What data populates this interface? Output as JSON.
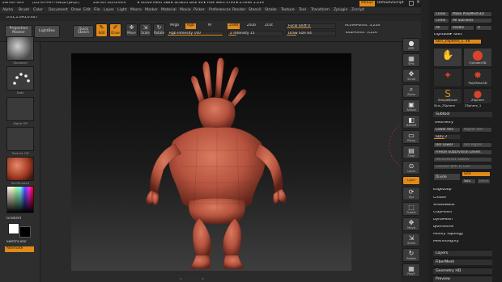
{
  "title_bar": {
    "app": "ZBrush 4R4",
    "build": "[ZDTK-PMFF-HNQDTJBQZ]",
    "document": "ZBrush Document",
    "stats": "▸ Active Mem 588 ▸ Scratch Disk 93 ▸ Free Mem 3793 ▸ ZTimer 2.219",
    "menus_button": "Menus",
    "script_button": "DefaultZScript"
  },
  "menu_bar": [
    "Alpha",
    "Brush",
    "Color",
    "Document",
    "Draw",
    "Edit",
    "File",
    "Layer",
    "Light",
    "Macro",
    "Marker",
    "Material",
    "Movie",
    "Picker",
    "Preferences",
    "Render",
    "Stencil",
    "Stroke",
    "Texture",
    "Tool",
    "Transform",
    "Zplugin",
    "Zscript"
  ],
  "coords": "0.01,1.095,0.447",
  "shelf": {
    "projection_master": "Projection Master",
    "lightbox": "LightBox",
    "quick_sketch": "Quick Sketch",
    "tools": [
      {
        "label": "Edit",
        "glyph": "✎",
        "active": true
      },
      {
        "label": "Draw",
        "glyph": "✐",
        "active": true
      },
      {
        "label": "Move",
        "glyph": "✥",
        "active": false
      },
      {
        "label": "Scale",
        "glyph": "⇲",
        "active": false
      },
      {
        "label": "Rotate",
        "glyph": "↻",
        "active": false
      }
    ],
    "mrgb": "Mrgb",
    "rgb": "Rgb",
    "m": "M",
    "rgb_intensity": "Rgb Intensity 100",
    "zadd": "Zadd",
    "zsub": "Zsub",
    "zcut": "Zcut",
    "z_intensity": "Z Intensity 15",
    "focal_shift": "Focal Shift 0",
    "draw_size": "Draw Size 64",
    "active_points": "ActivePoints: 3,226",
    "total_points": "TotalPoints: 3,226"
  },
  "left_tray": {
    "brush_caption": "Standard",
    "stroke_caption": "Dots",
    "alpha_caption": "Alpha Off",
    "texture_caption": "Texture Off",
    "material_caption": "SkinShade4",
    "gradient": "Gradient",
    "switch_color": "SwitchColor",
    "alternate": "Alternate"
  },
  "right_icons": [
    {
      "label": "BPR",
      "glyph": "●"
    },
    {
      "label": "SPix",
      "glyph": "▦"
    },
    {
      "label": "Scroll",
      "glyph": "✥"
    },
    {
      "label": "Zoom",
      "glyph": "⌕"
    },
    {
      "label": "Actual",
      "glyph": "▣"
    },
    {
      "label": "AAHalf",
      "glyph": "◧"
    },
    {
      "label": "Persp",
      "glyph": "▭"
    },
    {
      "label": "Floor",
      "glyph": "▤"
    },
    {
      "label": "Local",
      "glyph": "⊙"
    },
    {
      "label": "Lsym",
      "glyph": "xyz"
    },
    {
      "label": "Xyz",
      "glyph": "⟳"
    },
    {
      "label": "",
      "glyph": "⟲"
    },
    {
      "label": "Frame",
      "glyph": "⬚"
    },
    {
      "label": "Move",
      "glyph": "✥"
    },
    {
      "label": "Scale",
      "glyph": "⇲"
    },
    {
      "label": "Rotate",
      "glyph": "↻"
    },
    {
      "label": "PolyF",
      "glyph": "▦"
    }
  ],
  "palette": {
    "clone": "Clone",
    "make_polymesh": "Make PolyMesh3D",
    "clone2": "Clone",
    "all_subtools": "All SubTools",
    "all": "All",
    "visible": "Visible",
    "r": "R",
    "lightbox_tools": "Lightbox▸ Tools",
    "current_tool": "Skin_ZSphere_1. 48",
    "subtools_grid": [
      {
        "name": "",
        "glyph": "✋"
      },
      {
        "name": "Cylinder3D",
        "glyph": "⬤"
      },
      {
        "name": "",
        "glyph": "✦"
      },
      {
        "name": "PolyMesh3D",
        "glyph": "✸"
      },
      {
        "name": "SimpleBrush",
        "glyph": "S"
      },
      {
        "name": "ZSphere",
        "glyph": "●"
      },
      {
        "name": "Skin_ZSphere",
        "glyph": "✋"
      },
      {
        "name": "ZSphere_1",
        "glyph": "●"
      }
    ],
    "subtool_header": "Subtool",
    "geometry_header": "Geometry",
    "lower_res": "Lower Res",
    "higher_res": "Higher Res",
    "sdiv": "SDiv 2",
    "del_lower": "Del Lower",
    "del_higher": "Del Higher",
    "freeze_subdiv": "Freeze SubDivision Levels",
    "reconstruct": "Reconstruct Subdiv",
    "convert_bpr": "Convert BPR To Geo",
    "divide": "Divide",
    "smt": "Smt",
    "suv": "Suv",
    "rsmt": "ReUV",
    "items": [
      "EdgeLoop",
      "Crease",
      "ShadowBox",
      "ClayPolish",
      "DynaMesh",
      "qRemesher",
      "Modify Topology",
      "MeshIntegrity"
    ],
    "layers": "Layers",
    "fibermesh": "FiberMesh",
    "geometry_hd": "Geometry HD",
    "preview": "Preview"
  },
  "colors": {
    "accent": "#e08a19",
    "model": "#b5533f",
    "canvas_top": "#060606",
    "canvas_bottom": "#3e3e3e"
  }
}
